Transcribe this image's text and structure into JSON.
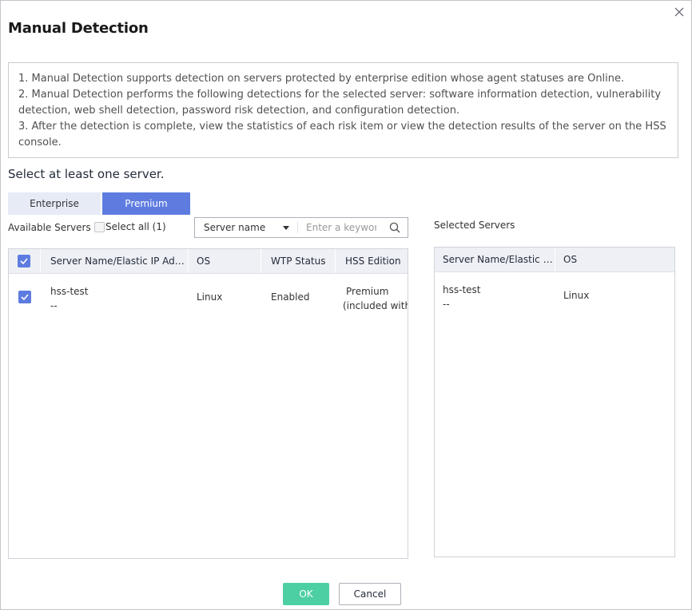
{
  "dialog": {
    "title": "Manual Detection"
  },
  "notice": {
    "lines": [
      "1. Manual Detection supports detection on servers protected by enterprise edition whose agent statuses are Online.",
      "2. Manual Detection performs the following detections for the selected server: software information detection, vulnerability detection, web shell detection, password risk detection, and configuration detection.",
      "3. After the detection is complete, view the statistics of each risk item or view the detection results of the server on the HSS console."
    ]
  },
  "select_hint": "Select at least one server.",
  "tabs": [
    {
      "label": "Enterprise",
      "active": false
    },
    {
      "label": "Premium",
      "active": true
    }
  ],
  "available": {
    "label": "Available Servers",
    "select_all_label": "Select all (1)",
    "search": {
      "type_value": "Server name",
      "placeholder": "Enter a keyword"
    },
    "columns": [
      "Server Name/Elastic IP Address",
      "OS",
      "WTP Status",
      "HSS Edition"
    ],
    "rows": [
      {
        "checked": true,
        "name": "hss-test",
        "ip": "--",
        "os": "Linux",
        "wtp_status": "Enabled",
        "edition_line1": "Premium",
        "edition_line2": "(included with WTP)"
      }
    ]
  },
  "selected": {
    "label": "Selected Servers",
    "columns": [
      "Server Name/Elastic IP Address",
      "OS"
    ],
    "rows": [
      {
        "name": "hss-test",
        "ip": "--",
        "os": "Linux"
      }
    ]
  },
  "buttons": {
    "ok": "OK",
    "cancel": "Cancel"
  },
  "colors": {
    "accent": "#5e7ce0",
    "ok_button": "#4ccfa3",
    "tab_inactive": "#e6ebf5",
    "table_header": "#eef0f5"
  }
}
